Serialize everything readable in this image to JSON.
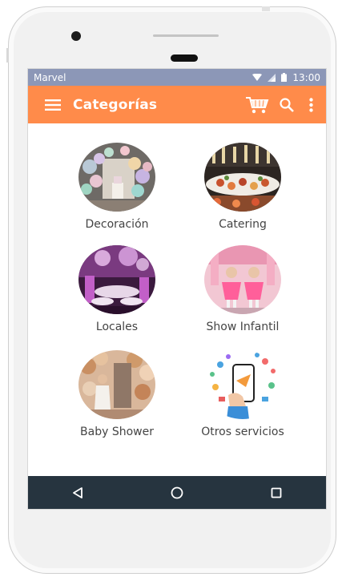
{
  "status_bar": {
    "carrier": "Marvel",
    "time": "13:00"
  },
  "toolbar": {
    "title": "Categorías",
    "menu_icon": "hamburger-menu-icon",
    "cart_icon": "shopping-cart-icon",
    "search_icon": "search-icon",
    "more_icon": "more-vertical-icon"
  },
  "categories": [
    {
      "label": "Decoración",
      "image": "balloon-decoration-photo"
    },
    {
      "label": "Catering",
      "image": "catering-food-photo"
    },
    {
      "label": "Locales",
      "image": "event-venue-photo"
    },
    {
      "label": "Show Infantil",
      "image": "kids-show-photo"
    },
    {
      "label": "Baby Shower",
      "image": "baby-shower-photo"
    },
    {
      "label": "Otros servicios",
      "image": "services-phone-illustration"
    }
  ],
  "nav_bar": {
    "back_icon": "back-triangle-icon",
    "home_icon": "home-circle-icon",
    "recents_icon": "recents-square-icon"
  },
  "colors": {
    "status_bar": "#8c97b7",
    "toolbar": "#ff8b4a",
    "nav_bar": "#26343f"
  }
}
